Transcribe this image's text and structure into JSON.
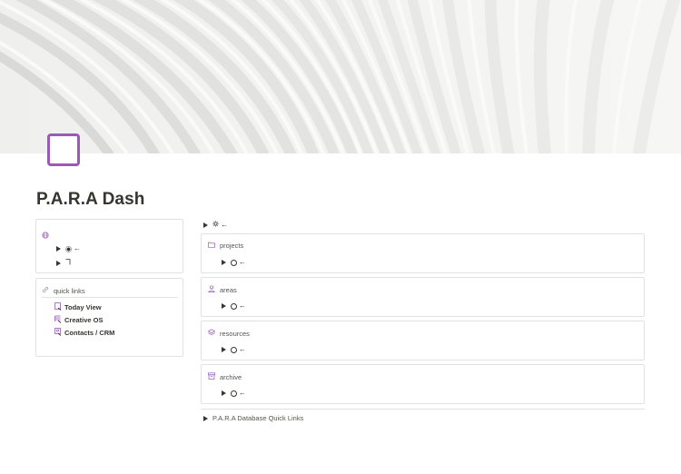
{
  "page": {
    "title": "P.A.R.A Dash"
  },
  "left_top_card": {
    "globe_icon": "globe-icon",
    "toggles": [
      {
        "icon": "radio-icon",
        "arrow": "←"
      },
      {
        "icon": "corner-icon",
        "arrow": ""
      }
    ]
  },
  "quick_links": {
    "heading": "quick links",
    "items": [
      {
        "label": "Today View",
        "icon": "page-link-icon"
      },
      {
        "label": "Creative OS",
        "icon": "database-link-icon"
      },
      {
        "label": "Contacts / CRM",
        "icon": "database-link-icon"
      }
    ]
  },
  "top_toggle": {
    "arrow": "←",
    "icon": "gear-icon"
  },
  "sections": [
    {
      "title": "projects",
      "icon": "folder-icon",
      "arrow": "←"
    },
    {
      "title": "areas",
      "icon": "person-icon",
      "arrow": "←"
    },
    {
      "title": "resources",
      "icon": "layers-icon",
      "arrow": "←"
    },
    {
      "title": "archive",
      "icon": "archive-icon",
      "arrow": "←"
    }
  ],
  "footer_toggle": {
    "label": "P.A.R.A Database Quick Links"
  },
  "colors": {
    "accent_purple": "#9b59b6",
    "text": "#37352f",
    "border": "#e3e2e0"
  }
}
